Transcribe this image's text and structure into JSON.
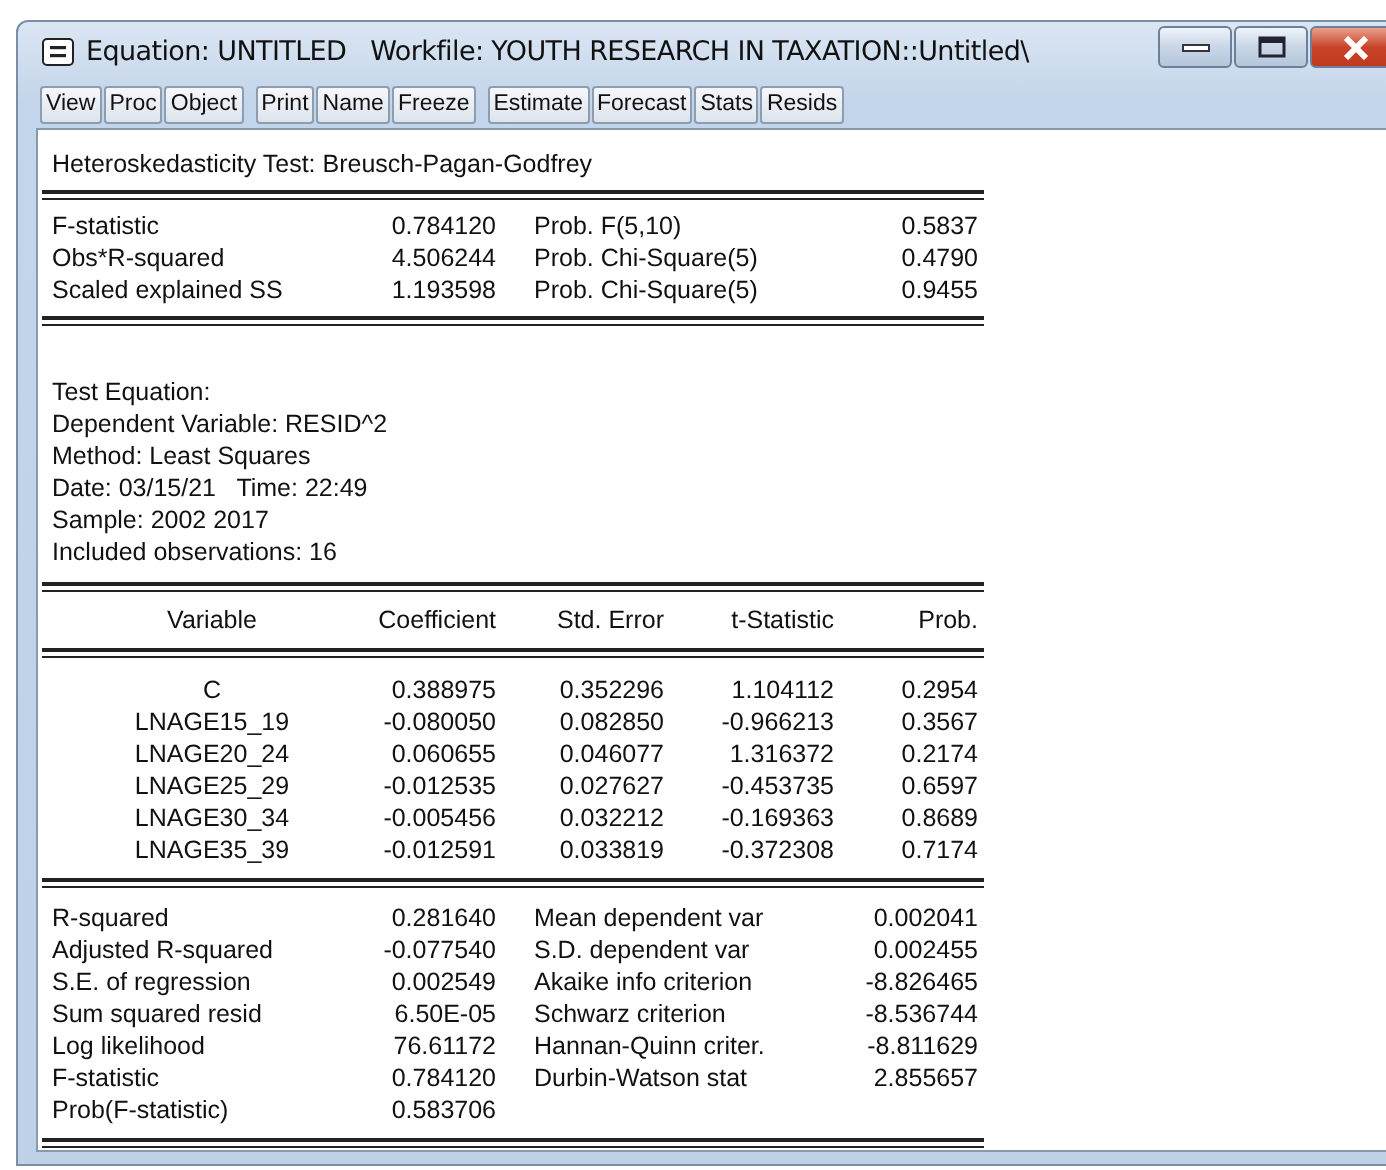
{
  "window": {
    "title": "Equation: UNTITLED   Workfile: YOUTH RESEARCH IN TAXATION::Untitled\\"
  },
  "toolbar": [
    [
      "View",
      "Proc",
      "Object"
    ],
    [
      "Print",
      "Name",
      "Freeze"
    ],
    [
      "Estimate",
      "Forecast",
      "Stats",
      "Resids"
    ]
  ],
  "output": {
    "title": "Heteroskedasticity Test: Breusch-Pagan-Godfrey",
    "test_stats": [
      [
        "F-statistic",
        "0.784120",
        "Prob. F(5,10)",
        "0.5837"
      ],
      [
        "Obs*R-squared",
        "4.506244",
        "Prob. Chi-Square(5)",
        "0.4790"
      ],
      [
        "Scaled explained SS",
        "1.193598",
        "Prob. Chi-Square(5)",
        "0.9455"
      ]
    ],
    "info": [
      "Test Equation:",
      "Dependent Variable: RESID^2",
      "Method: Least Squares",
      "Date: 03/15/21   Time: 22:49",
      "Sample: 2002 2017",
      "Included observations: 16"
    ],
    "coefficients": {
      "columns": [
        "Variable",
        "Coefficient",
        "Std. Error",
        "t-Statistic",
        "Prob."
      ],
      "rows": [
        [
          "C",
          "0.388975",
          "0.352296",
          "1.104112",
          "0.2954"
        ],
        [
          "LNAGE15_19",
          "-0.080050",
          "0.082850",
          "-0.966213",
          "0.3567"
        ],
        [
          "LNAGE20_24",
          "0.060655",
          "0.046077",
          "1.316372",
          "0.2174"
        ],
        [
          "LNAGE25_29",
          "-0.012535",
          "0.027627",
          "-0.453735",
          "0.6597"
        ],
        [
          "LNAGE30_34",
          "-0.005456",
          "0.032212",
          "-0.169363",
          "0.8689"
        ],
        [
          "LNAGE35_39",
          "-0.012591",
          "0.033819",
          "-0.372308",
          "0.7174"
        ]
      ]
    },
    "summary": [
      [
        "R-squared",
        "0.281640",
        "Mean dependent var",
        "0.002041"
      ],
      [
        "Adjusted R-squared",
        "-0.077540",
        "S.D. dependent var",
        "0.002455"
      ],
      [
        "S.E. of regression",
        "0.002549",
        "Akaike info criterion",
        "-8.826465"
      ],
      [
        "Sum squared resid",
        "6.50E-05",
        "Schwarz criterion",
        "-8.536744"
      ],
      [
        "Log likelihood",
        "76.61172",
        "Hannan-Quinn criter.",
        "-8.811629"
      ],
      [
        "F-statistic",
        "0.784120",
        "Durbin-Watson stat",
        "2.855657"
      ],
      [
        "Prob(F-statistic)",
        "0.583706"
      ]
    ]
  }
}
